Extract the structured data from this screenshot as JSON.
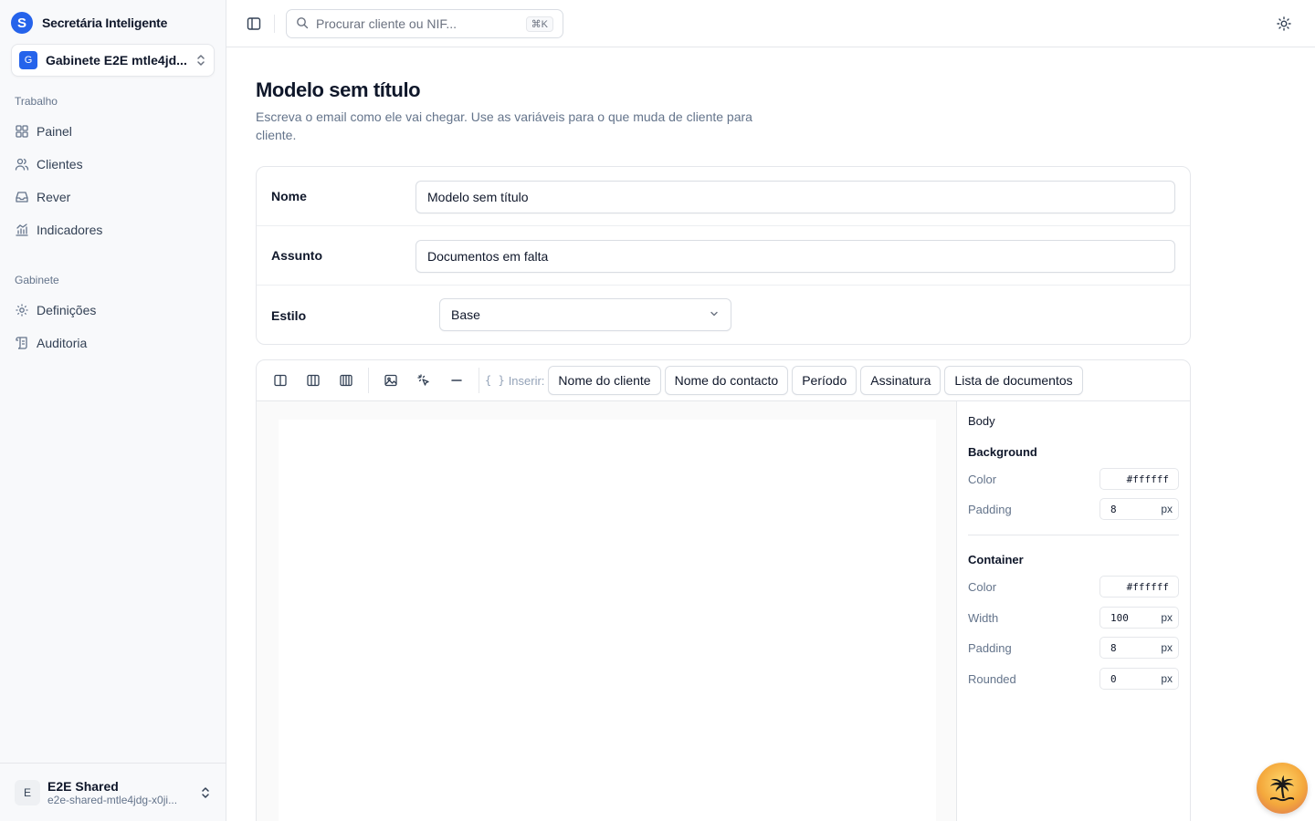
{
  "app": {
    "name": "Secretária Inteligente",
    "logo_letter": "S"
  },
  "org": {
    "badge": "G",
    "name": "Gabinete E2E mtle4jd..."
  },
  "sidebar": {
    "sections": [
      {
        "label": "Trabalho",
        "items": [
          {
            "label": "Painel",
            "icon": "grid-icon"
          },
          {
            "label": "Clientes",
            "icon": "users-icon"
          },
          {
            "label": "Rever",
            "icon": "inbox-icon"
          },
          {
            "label": "Indicadores",
            "icon": "chart-icon"
          }
        ]
      },
      {
        "label": "Gabinete",
        "items": [
          {
            "label": "Definições",
            "icon": "gear-icon"
          },
          {
            "label": "Auditoria",
            "icon": "scroll-icon"
          }
        ]
      }
    ]
  },
  "user": {
    "avatar": "E",
    "name": "E2E Shared",
    "email": "e2e-shared-mtle4jdg-x0ji..."
  },
  "search": {
    "placeholder": "Procurar cliente ou NIF...",
    "shortcut": "⌘K"
  },
  "page": {
    "title": "Modelo sem título",
    "description": "Escreva o email como ele vai chegar. Use as variáveis para o que muda de cliente para cliente."
  },
  "form": {
    "name_label": "Nome",
    "name_value": "Modelo sem título",
    "subject_label": "Assunto",
    "subject_value": "Documentos em falta",
    "style_label": "Estilo",
    "style_value": "Base"
  },
  "toolbar": {
    "insert_braces": "{ }",
    "insert_label": "Inserir:",
    "variables": [
      "Nome do cliente",
      "Nome do contacto",
      "Período",
      "Assinatura",
      "Lista de documentos"
    ]
  },
  "props": {
    "title": "Body",
    "background": {
      "heading": "Background",
      "color_label": "Color",
      "color_value": "#ffffff",
      "padding_label": "Padding",
      "padding_value": "8",
      "padding_unit": "px"
    },
    "container": {
      "heading": "Container",
      "color_label": "Color",
      "color_value": "#ffffff",
      "width_label": "Width",
      "width_value": "100",
      "width_unit": "px",
      "padding_label": "Padding",
      "padding_value": "8",
      "padding_unit": "px",
      "rounded_label": "Rounded",
      "rounded_value": "0",
      "rounded_unit": "px"
    }
  },
  "colors": {
    "accent": "#2563eb",
    "border": "#e5e7eb",
    "muted_text": "#64748b"
  }
}
